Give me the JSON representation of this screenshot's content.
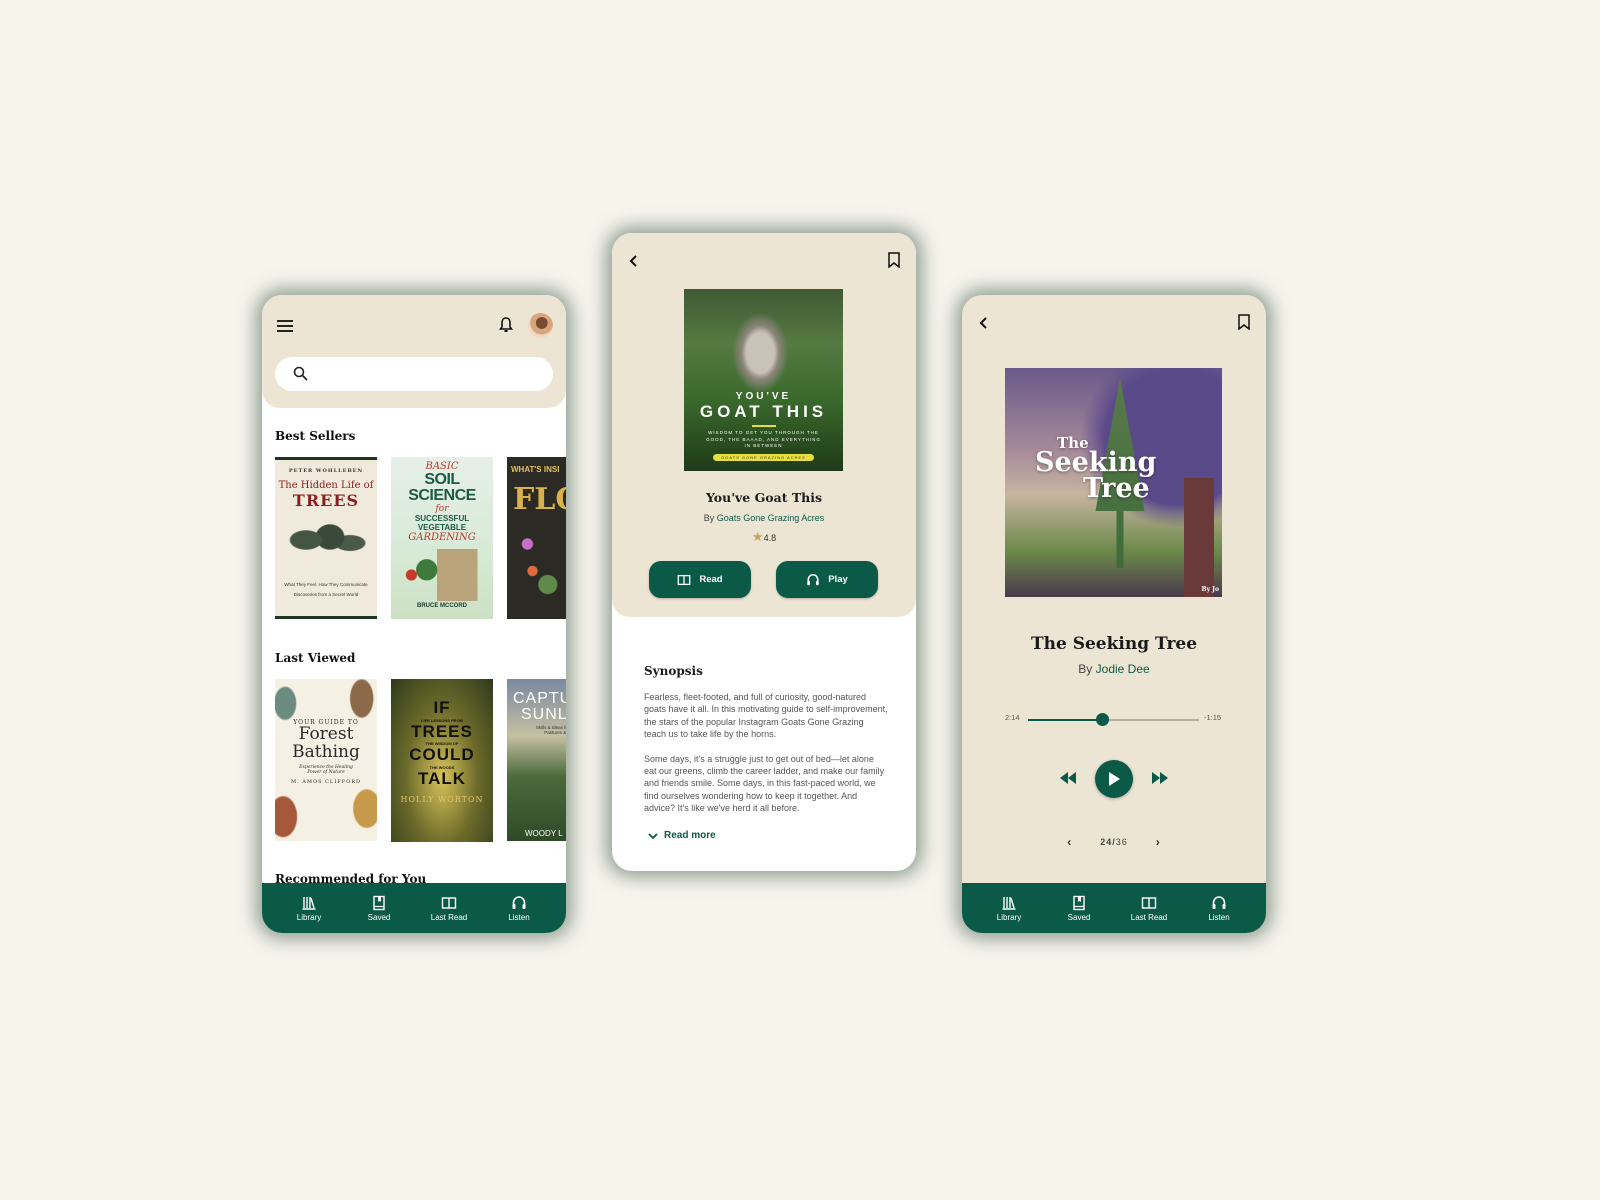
{
  "colors": {
    "background": "#f7f4ec",
    "cream": "#ede5d3",
    "primary_green": "#0b5a47",
    "star": "#c9a45b"
  },
  "bottom_nav": [
    {
      "icon": "library-icon",
      "label": "Library"
    },
    {
      "icon": "saved-icon",
      "label": "Saved"
    },
    {
      "icon": "book-open-icon",
      "label": "Last Read"
    },
    {
      "icon": "headphones-icon",
      "label": "Listen"
    }
  ],
  "home": {
    "header": {
      "menu_icon": "menu-icon",
      "notification_icon": "bell-icon",
      "avatar": "user-avatar"
    },
    "search": {
      "placeholder": "",
      "value": ""
    },
    "sections": [
      {
        "title": "Best Sellers",
        "books": [
          {
            "author": "PETER WOHLLEBEN",
            "title_line1": "The Hidden Life of",
            "title_line2": "TREES",
            "subtitle": "What They Feel, How They Communicate",
            "tagline": "Discoveries from a Secret World"
          },
          {
            "title_line1": "BASIC",
            "title_line2": "SOIL SCIENCE",
            "title_line3": "for",
            "title_line4": "SUCCESSFUL VEGETABLE",
            "title_line5": "GARDENING",
            "author": "BRUCE MCCORD"
          },
          {
            "title_line1": "WHAT'S INSI",
            "title_line2": "FLO"
          }
        ]
      },
      {
        "title": "Last Viewed",
        "books": [
          {
            "title_line1": "YOUR GUIDE TO",
            "title_line2": "Forest",
            "title_line3": "Bathing",
            "subtitle": "Experience the Healing Power of Nature",
            "author": "M. AMOS CLIFFORD"
          },
          {
            "title_line1": "IF",
            "small1": "LIFE LESSONS FROM",
            "title_line2": "TREES",
            "small2": "THE WISDOM OF",
            "title_line3": "COULD",
            "small3": "THE WOODS",
            "title_line4": "TALK",
            "author": "HOLLY WORTON"
          },
          {
            "title_line1": "CAPTU",
            "title_line2": "SUNLI",
            "subtitle": "Skills & Ideas for Sustainable Pastures & Grassfed",
            "author": "WOODY L"
          }
        ]
      },
      {
        "title": "Recommended for You"
      }
    ]
  },
  "detail": {
    "cover": {
      "line1": "YOU'VE",
      "line2": "GOAT THIS",
      "subtitle": "WISDOM TO GET YOU THROUGH THE GOOD, THE BAAAD, AND EVERYTHING IN BETWEEN",
      "pill": "GOATS GONE GRAZING ACRES"
    },
    "title": "You've Goat This",
    "by_prefix": "By",
    "author": "Goats Gone Grazing Acres",
    "rating": "4.8",
    "read_label": "Read",
    "play_label": "Play",
    "synopsis_title": "Synopsis",
    "synopsis_paragraphs": [
      "Fearless, fleet-footed, and full of curiosity, good-natured goats have it all. In this motivating guide to self-improvement, the stars of the popular Instagram Goats Gone Grazing teach us to take life by the horns.",
      "Some days, it's a struggle just to get out of bed—let alone eat our greens, climb the career ladder, and make our family and friends smile. Some days, in this fast-paced world, we find ourselves wondering how to keep it together. And advice? It's like we've herd it all before."
    ],
    "read_more": "Read more"
  },
  "player": {
    "cover": {
      "line1": "The",
      "line2": "Seeking",
      "line3": "Tree",
      "byline": "By Jo"
    },
    "title": "The Seeking Tree",
    "by_prefix": "By",
    "author": "Jodie Dee",
    "elapsed": "2:14",
    "remaining": "-1:15",
    "progress_fraction": 0.43,
    "chapter_current": "24",
    "chapter_total": "36"
  }
}
